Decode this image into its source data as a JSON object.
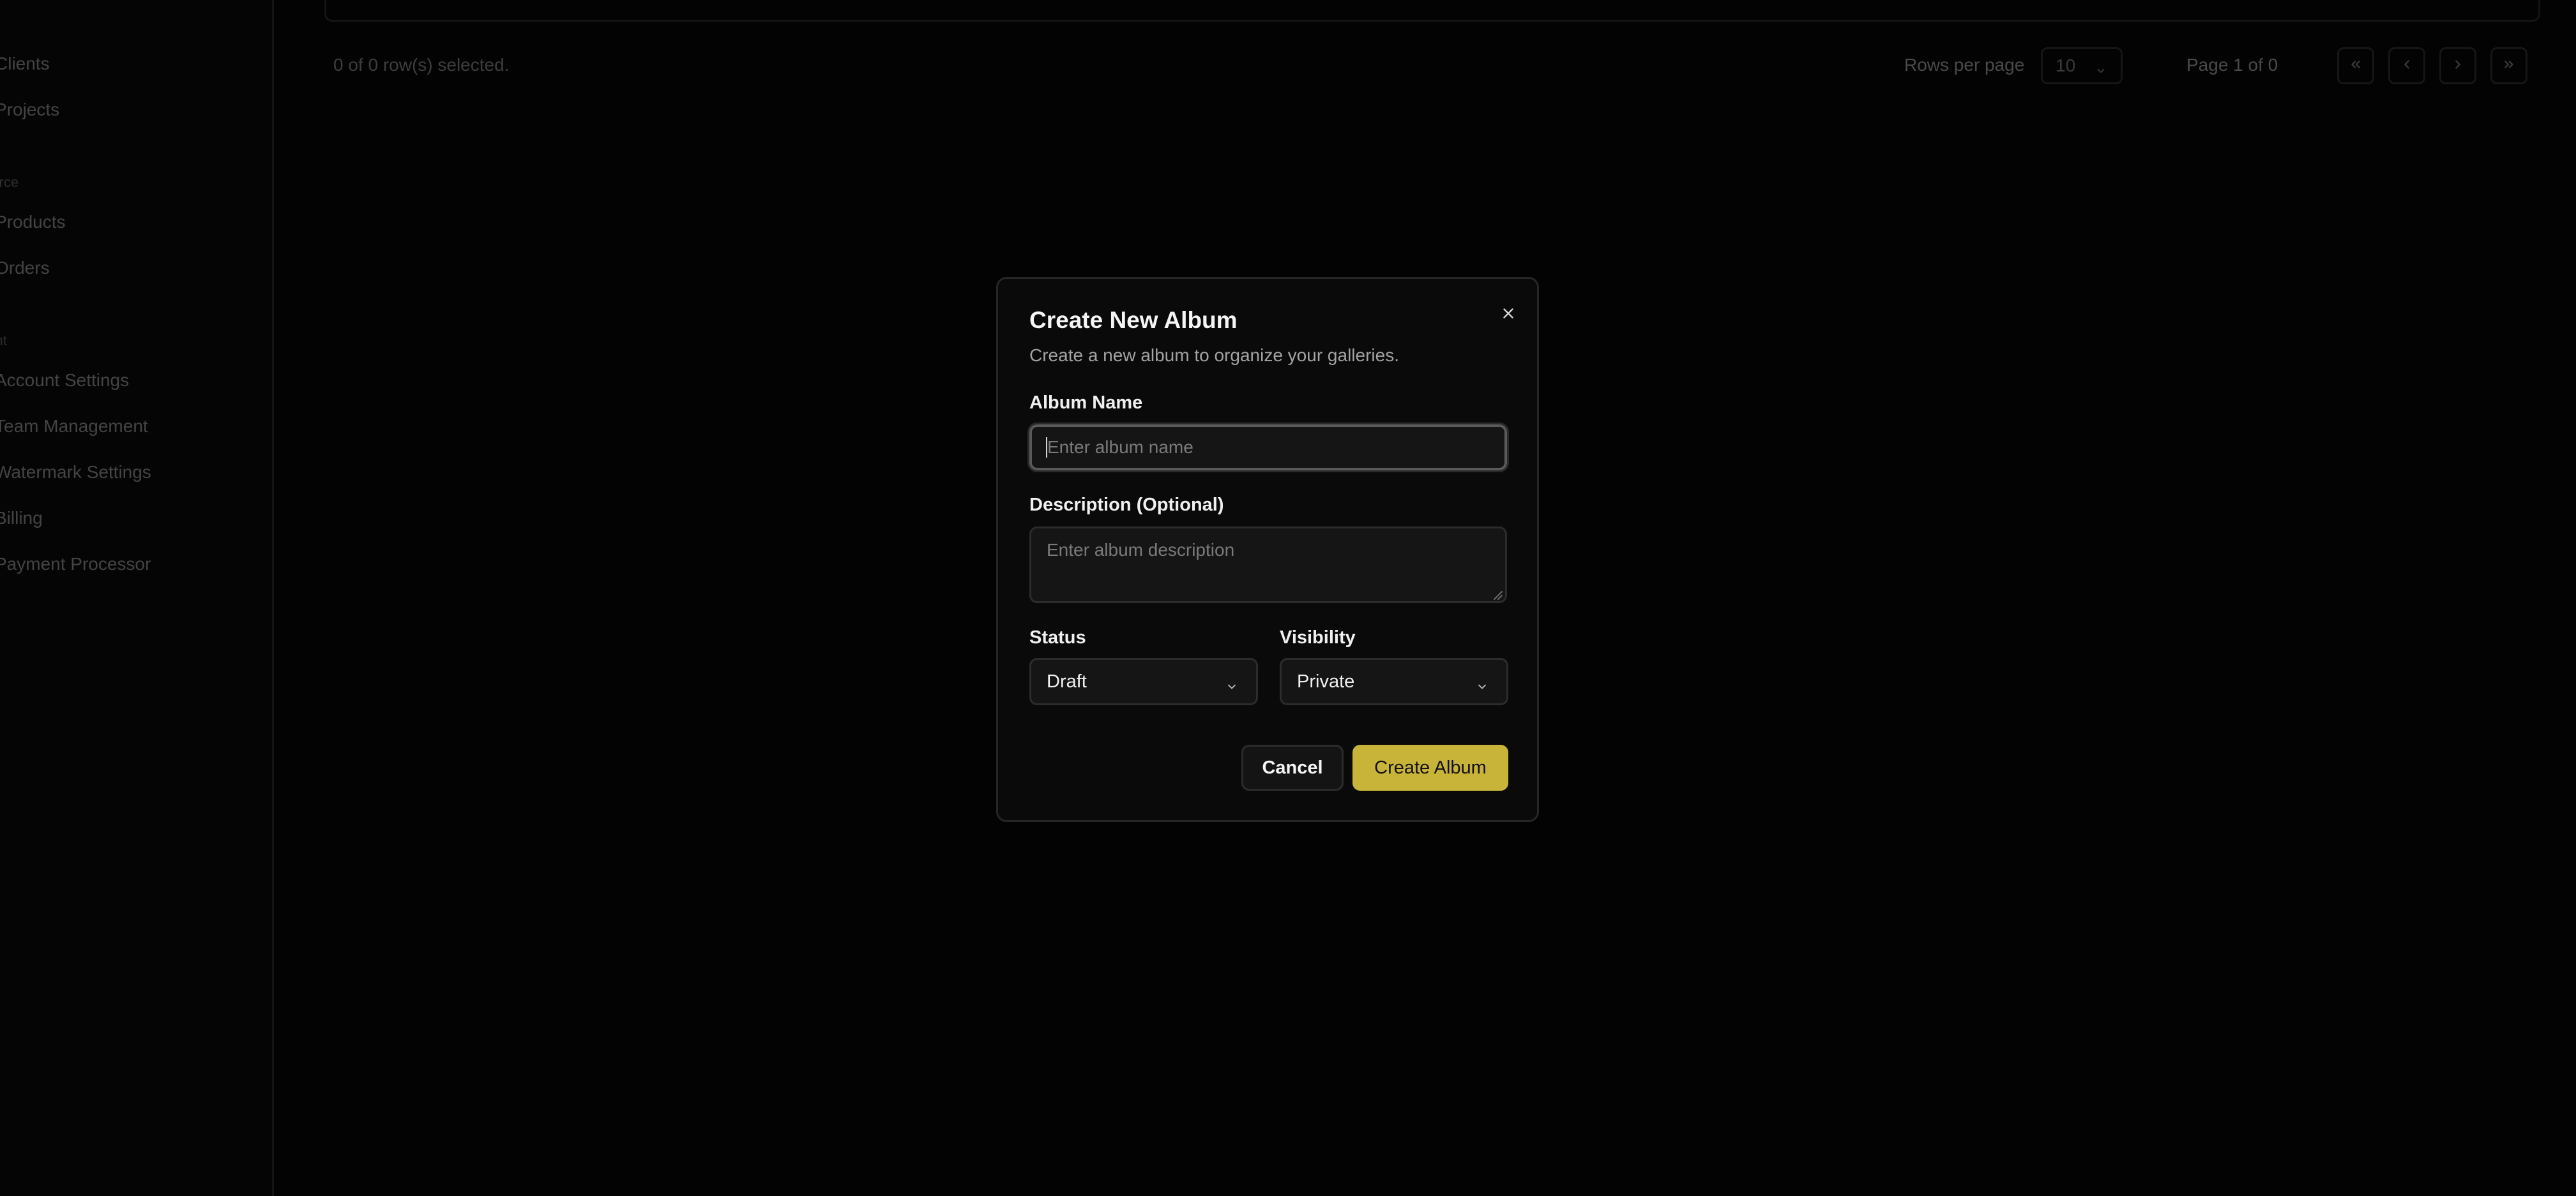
{
  "sidebar": {
    "items": [
      {
        "label": "Clients"
      },
      {
        "label": "Projects"
      },
      {
        "label": "Products"
      },
      {
        "label": "Orders"
      },
      {
        "label": "Account Settings"
      },
      {
        "label": "Team Management"
      },
      {
        "label": "Watermark Settings"
      },
      {
        "label": "Billing"
      },
      {
        "label": "Payment Processor"
      }
    ],
    "sections": [
      {
        "label": "merce"
      },
      {
        "label": "ount"
      }
    ]
  },
  "table_footer": {
    "selected_text": "0 of 0 row(s) selected.",
    "rows_per_page_label": "Rows per page",
    "rows_per_page_value": "10",
    "page_indicator": "Page 1 of 0",
    "pager_icons": [
      "chevrons-left-icon",
      "chevron-left-icon",
      "chevron-right-icon",
      "chevrons-right-icon"
    ]
  },
  "modal": {
    "title": "Create New Album",
    "subtitle": "Create a new album to organize your galleries.",
    "close_icon": "close-icon",
    "album_name": {
      "label": "Album Name",
      "value": "",
      "placeholder": "Enter album name"
    },
    "description": {
      "label": "Description (Optional)",
      "value": "",
      "placeholder": "Enter album description"
    },
    "status": {
      "label": "Status",
      "selected": "Draft"
    },
    "visibility": {
      "label": "Visibility",
      "selected": "Private"
    },
    "cancel_label": "Cancel",
    "submit_label": "Create Album"
  },
  "colors": {
    "background": "#000000",
    "modal_background": "#0a0a0a",
    "accent": "#c9b43a",
    "text_primary": "#f5f5f5",
    "text_muted": "#a3a3a3"
  }
}
